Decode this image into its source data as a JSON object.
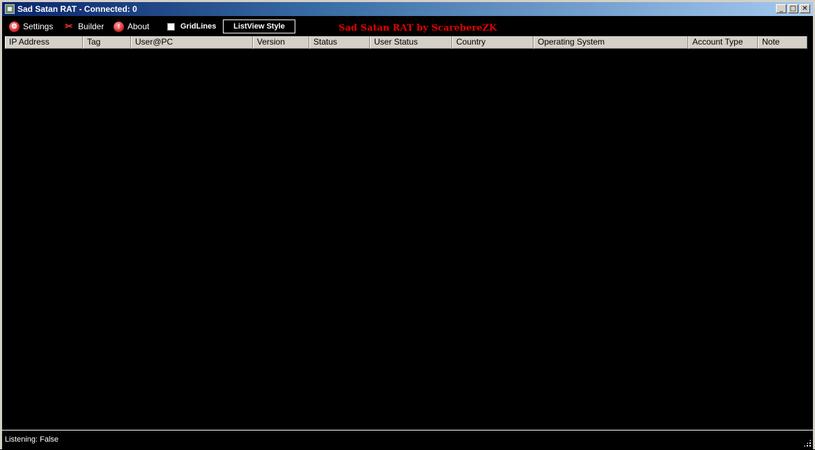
{
  "window": {
    "title": "Sad Satan RAT - Connected: 0",
    "minimize": "_",
    "maximize": "□",
    "close": "✕"
  },
  "toolbar": {
    "settings_label": "Settings",
    "builder_label": "Builder",
    "about_label": "About",
    "gridlines_label": "GridLines",
    "gridlines_checked": false,
    "listview_style_label": "ListView Style",
    "brand_text": "Sad Satan RAT by ScarebereZK"
  },
  "listview": {
    "columns": [
      "IP Address",
      "Tag",
      "User@PC",
      "Version",
      "Status",
      "User Status",
      "Country",
      "Operating System",
      "Account Type",
      "Note"
    ],
    "rows": []
  },
  "statusbar": {
    "text": "Listening: False"
  },
  "colors": {
    "background": "#000000",
    "brand": "#e00000",
    "header_bg": "#d4d0c8"
  }
}
